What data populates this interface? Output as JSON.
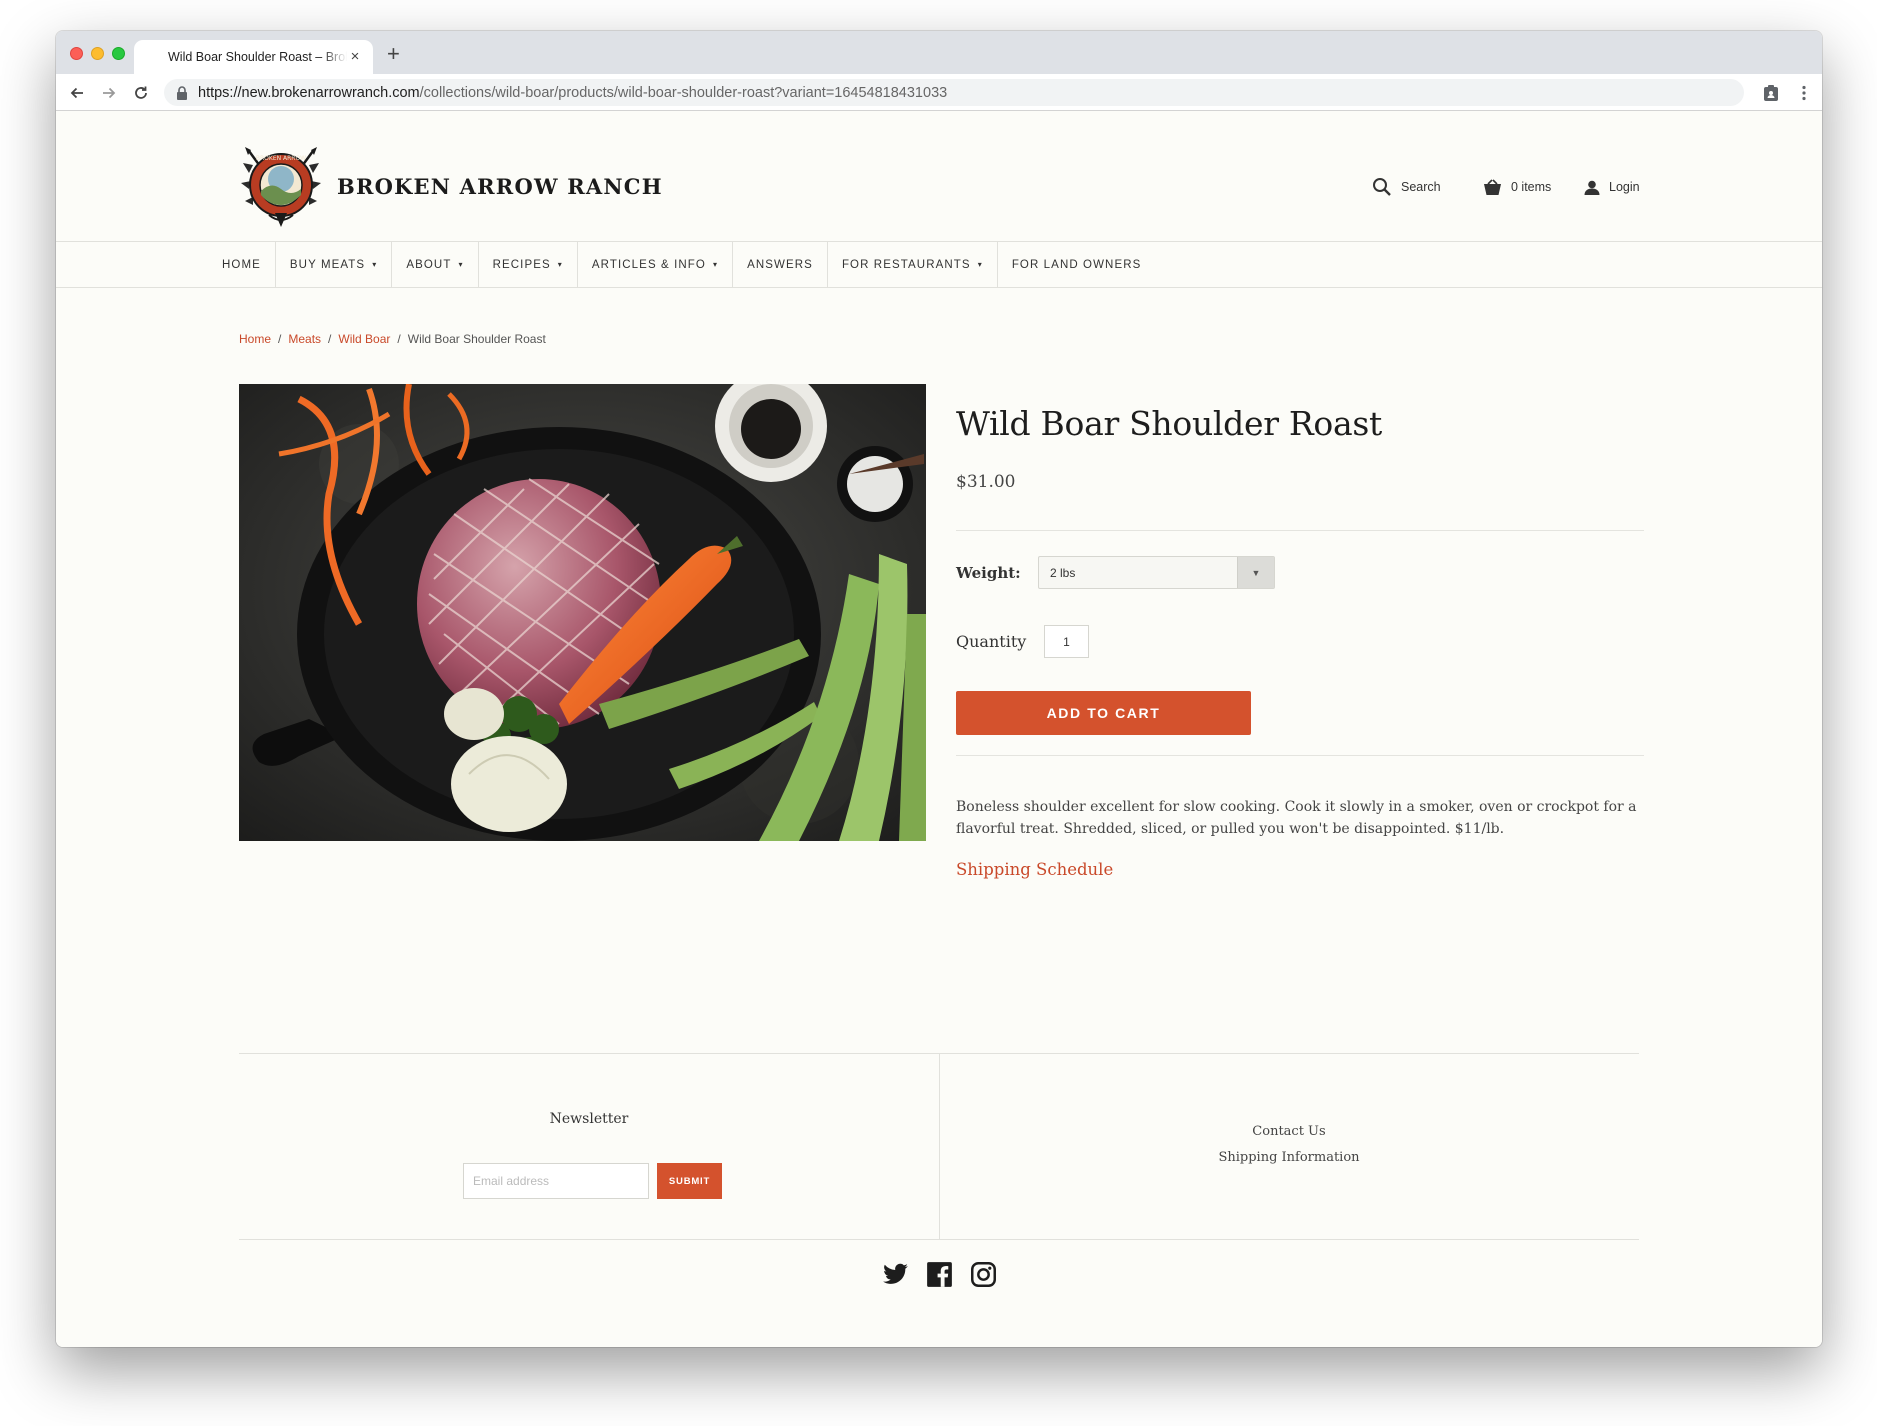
{
  "browser": {
    "tab_title": "Wild Boar Shoulder Roast – Broken Arrow Ranch",
    "url_host": "https://new.brokenarrowranch.com",
    "url_path": "/collections/wild-boar/products/wild-boar-shoulder-roast?variant=16454818431033"
  },
  "header": {
    "logo_text": "BROKEN ARROW RANCH",
    "search_label": "Search",
    "cart_label": "0 items",
    "login_label": "Login"
  },
  "nav": {
    "items": [
      {
        "label": "HOME"
      },
      {
        "label": "BUY MEATS"
      },
      {
        "label": "ABOUT"
      },
      {
        "label": "RECIPES"
      },
      {
        "label": "ARTICLES & INFO"
      },
      {
        "label": "ANSWERS"
      },
      {
        "label": "FOR RESTAURANTS"
      },
      {
        "label": "FOR LAND OWNERS"
      }
    ]
  },
  "breadcrumb": {
    "items": [
      {
        "label": "Home"
      },
      {
        "label": "Meats"
      },
      {
        "label": "Wild Boar"
      },
      {
        "label": "Wild Boar Shoulder Roast"
      }
    ],
    "separator": "/"
  },
  "product": {
    "title": "Wild Boar Shoulder Roast",
    "price": "$31.00",
    "weight_label": "Weight:",
    "weight_value": "2 lbs",
    "quantity_label": "Quantity",
    "quantity_value": "1",
    "add_to_cart": "ADD TO CART",
    "description": "Boneless shoulder excellent for slow cooking. Cook it slowly in a smoker, oven or crockpot for a flavorful treat. Shredded, sliced, or pulled you won't be disappointed. $11/lb.",
    "shipping_link": "Shipping Schedule"
  },
  "footer": {
    "newsletter_title": "Newsletter",
    "email_placeholder": "Email address",
    "submit_label": "SUBMIT",
    "links": [
      {
        "label": "Contact Us"
      },
      {
        "label": "Shipping Information"
      }
    ],
    "social": [
      "twitter-icon",
      "facebook-icon",
      "instagram-icon"
    ]
  },
  "colors": {
    "accent": "#d4522d",
    "link": "#c9492a",
    "background": "#fcfcf8"
  }
}
